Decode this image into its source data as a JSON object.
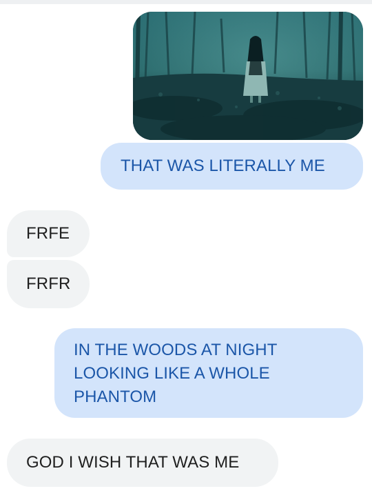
{
  "messages": [
    {
      "direction": "outgoing",
      "type": "image"
    },
    {
      "direction": "outgoing",
      "type": "text",
      "text": "THAT WAS LITERALLY ME"
    },
    {
      "direction": "incoming",
      "type": "text",
      "text": "FRFE"
    },
    {
      "direction": "incoming",
      "type": "text",
      "text": "FRFR"
    },
    {
      "direction": "outgoing",
      "type": "text",
      "lines": [
        "IN THE WOODS AT NIGHT",
        "LOOKING LIKE A WHOLE",
        "PHANTOM"
      ]
    },
    {
      "direction": "incoming",
      "type": "text",
      "text": "GOD I WISH THAT WAS ME"
    }
  ],
  "colors": {
    "outgoing_bubble": "#d3e4fb",
    "outgoing_text": "#1b56a8",
    "incoming_bubble": "#f1f3f4",
    "incoming_text": "#1f1f1f",
    "image_tint": "#1f5e66"
  }
}
